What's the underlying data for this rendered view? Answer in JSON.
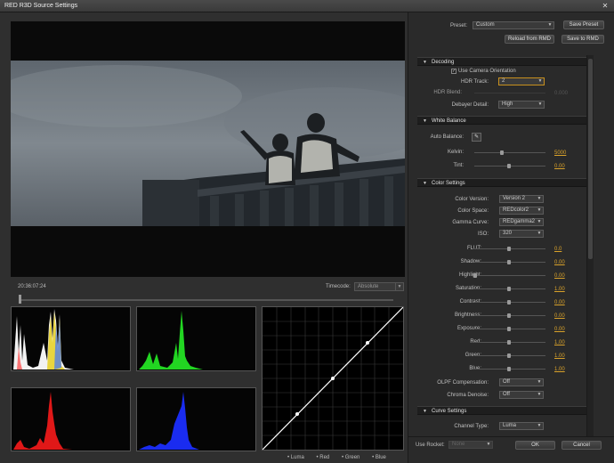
{
  "window": {
    "title": "RED R3D Source Settings",
    "close_glyph": "✕"
  },
  "timecode": {
    "value": "20:36:07:24",
    "label": "Timecode:",
    "selected": "Absolute"
  },
  "channels": [
    "Luma",
    "Red",
    "Green",
    "Blue"
  ],
  "preset": {
    "label": "Preset:",
    "selected": "Custom",
    "save_label": "Save Preset",
    "reload_label": "Reload from RMD",
    "save_rmd_label": "Save to RMD"
  },
  "decoding": {
    "header": "Decoding",
    "use_camera_orientation": "Use Camera Orientation",
    "hdr_track_label": "HDR Track:",
    "hdr_track_value": "2",
    "hdr_blend_label": "HDR Blend:",
    "hdr_blend_value": "0.000",
    "debayer_label": "Debayer Detail:",
    "debayer_value": "High"
  },
  "white_balance": {
    "header": "White Balance",
    "auto_label": "Auto Balance:",
    "kelvin_label": "Kelvin:",
    "kelvin_value": "5000",
    "tint_label": "Tint:",
    "tint_value": "0.00"
  },
  "color_settings": {
    "header": "Color Settings",
    "color_version_label": "Color Version:",
    "color_version_value": "Version 2",
    "color_space_label": "Color Space:",
    "color_space_value": "REDcolor2",
    "gamma_label": "Gamma Curve:",
    "gamma_value": "REDgamma2",
    "iso_label": "ISO:",
    "iso_value": "320",
    "sliders": [
      {
        "label": "FLUT:",
        "value": "0.0"
      },
      {
        "label": "Shadow:",
        "value": "0.00"
      },
      {
        "label": "Highlight:",
        "value": "0.00"
      },
      {
        "label": "Saturation:",
        "value": "1.00"
      },
      {
        "label": "Contrast:",
        "value": "0.00"
      },
      {
        "label": "Brightness:",
        "value": "0.00"
      },
      {
        "label": "Exposure:",
        "value": "0.00"
      },
      {
        "label": "Red:",
        "value": "1.00"
      },
      {
        "label": "Green:",
        "value": "1.00"
      },
      {
        "label": "Blue:",
        "value": "1.00"
      }
    ],
    "olpf_label": "OLPF Compensation:",
    "olpf_value": "Off",
    "chroma_label": "Chroma Denoise:",
    "chroma_value": "Off"
  },
  "curve_settings": {
    "header": "Curve Settings",
    "channel_type_label": "Channel Type:",
    "channel_type_value": "Luma"
  },
  "bottom": {
    "use_rocket_label": "Use Rocket:",
    "use_rocket_value": "None",
    "ok_label": "OK",
    "cancel_label": "Cancel"
  },
  "colors": {
    "accent": "#d9a22a",
    "highlight_border": "#c8901e"
  }
}
